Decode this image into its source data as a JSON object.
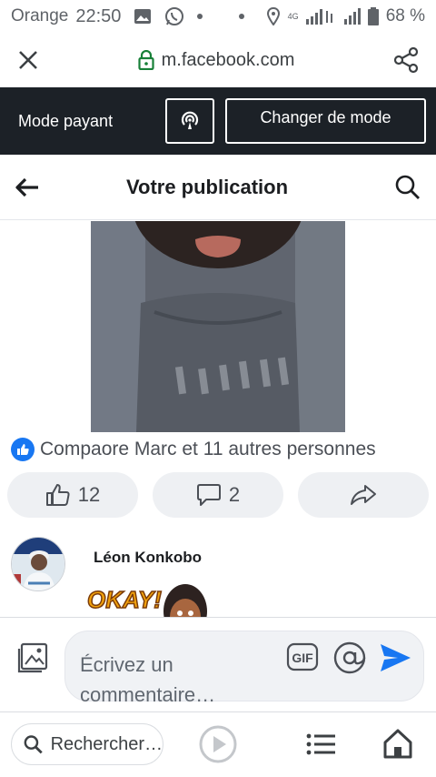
{
  "status_bar": {
    "carrier": "Orange",
    "time": "22:50",
    "network": "4G",
    "battery": "68 %"
  },
  "browser": {
    "url": "m.facebook.com"
  },
  "paid_mode": {
    "label": "Mode payant",
    "switch_button": "Changer de mode"
  },
  "header": {
    "title": "Votre publication"
  },
  "post": {
    "reactions_text": "Compaore Marc et 11 autres personnes",
    "like_count": "12",
    "comment_count": "2"
  },
  "comment": {
    "author": "Léon Konkobo",
    "sticker_text": "OKAY!"
  },
  "composer": {
    "placeholder": "Écrivez un commentaire…",
    "gif_label": "GIF"
  },
  "bottom_nav": {
    "search_label": "Rechercher…"
  },
  "colors": {
    "brand_blue": "#1877f2",
    "paid_bar": "#1c2127",
    "lock_green": "#188038"
  }
}
